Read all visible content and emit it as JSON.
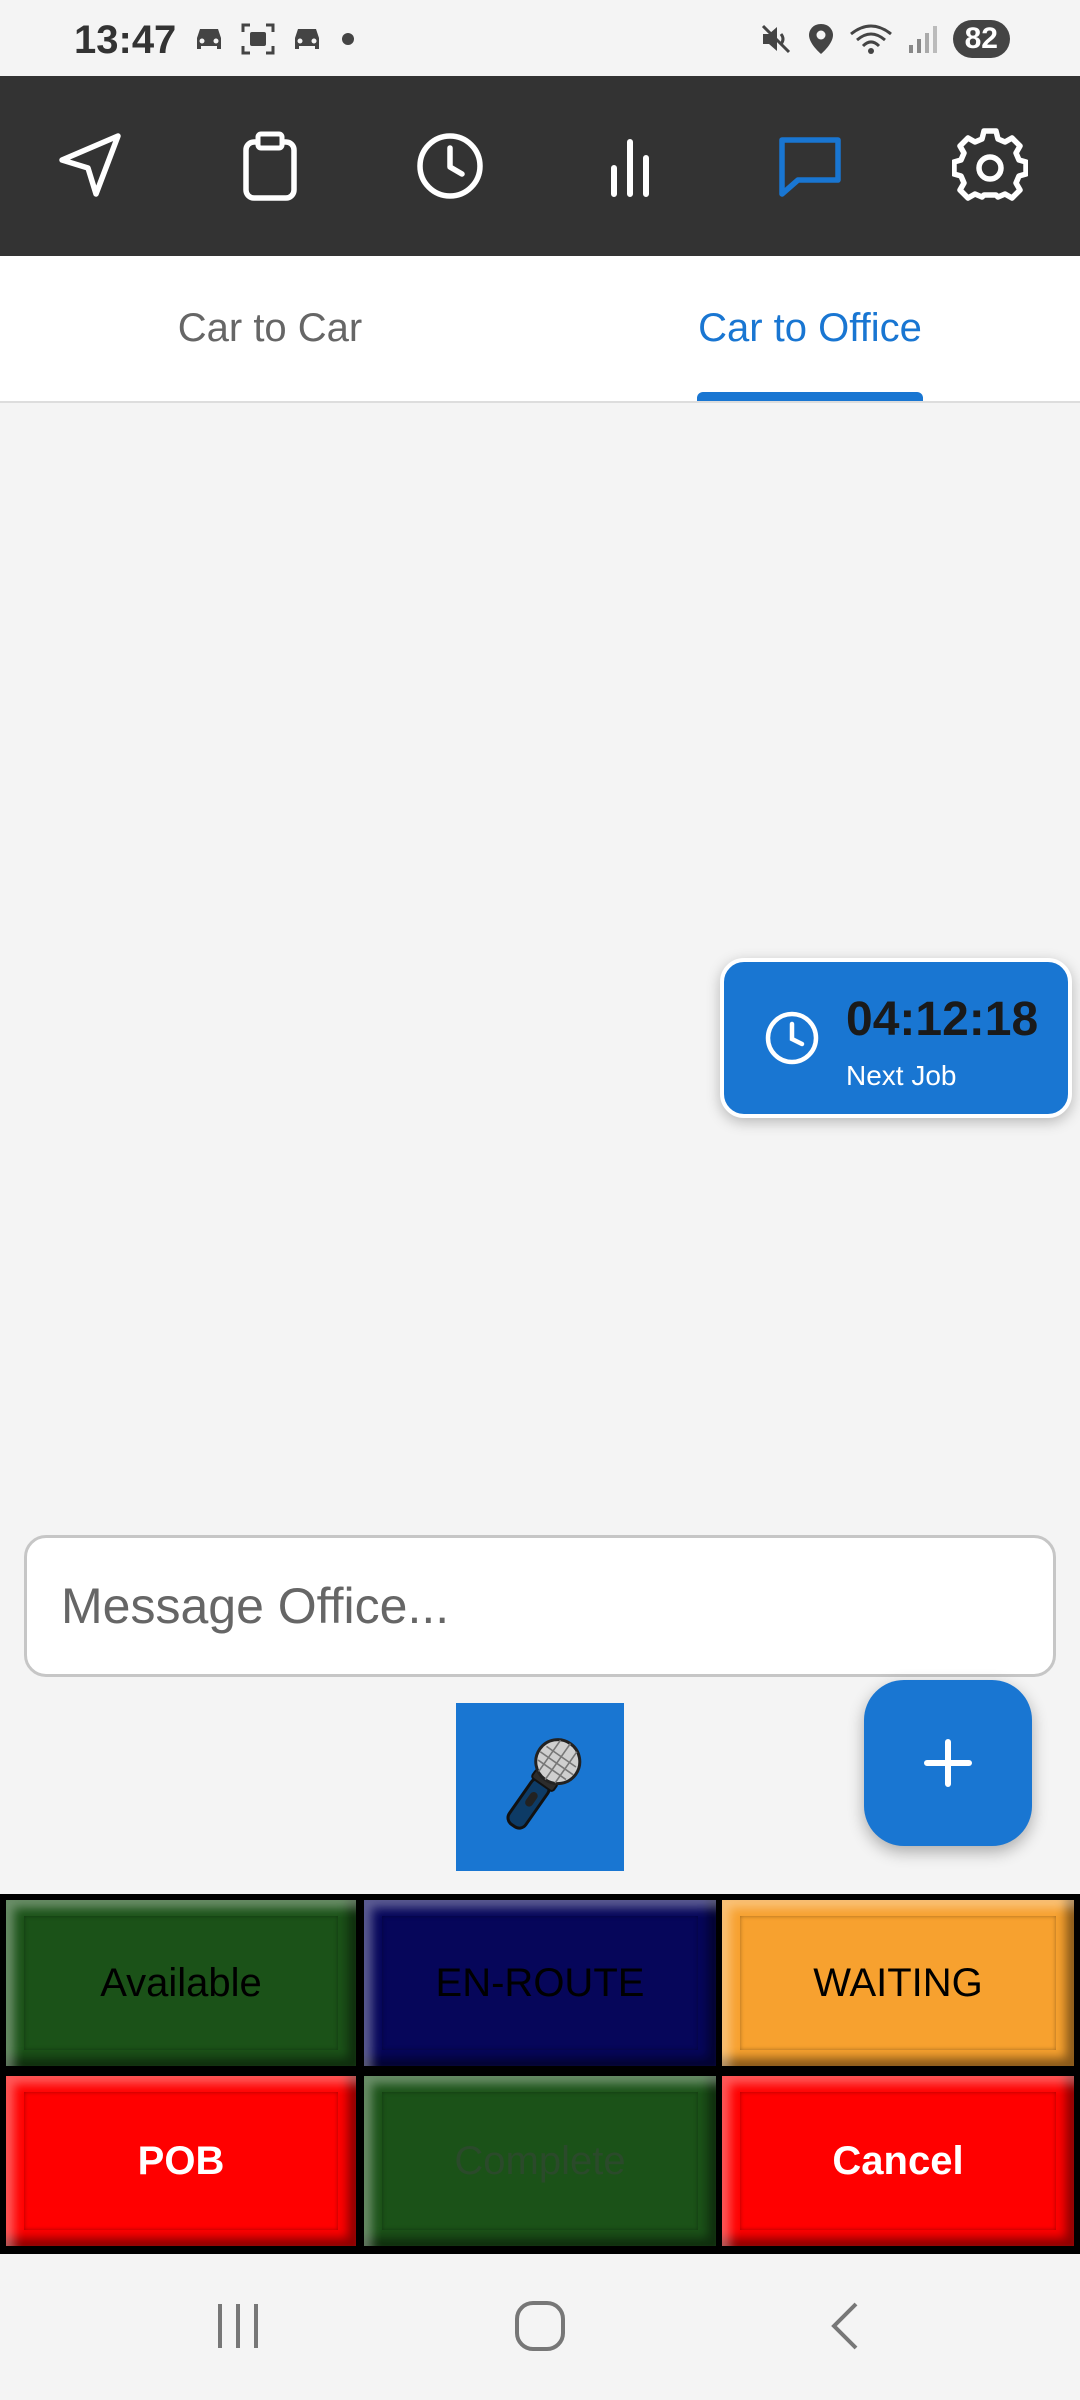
{
  "status_bar": {
    "time": "13:47",
    "battery": "82",
    "left_icons": [
      "car-icon",
      "screenshot-icon",
      "car-icon",
      "dot-icon"
    ],
    "right_icons": [
      "mute-icon",
      "location-icon",
      "wifi-icon",
      "signal-icon"
    ]
  },
  "top_nav": {
    "items": [
      {
        "icon": "navigation-arrow-icon",
        "active": false
      },
      {
        "icon": "clipboard-icon",
        "active": false
      },
      {
        "icon": "clock-icon",
        "active": false
      },
      {
        "icon": "bar-chart-icon",
        "active": false
      },
      {
        "icon": "message-icon",
        "active": true
      },
      {
        "icon": "gear-icon",
        "active": false
      }
    ],
    "active_color": "#1976d2"
  },
  "tabs": [
    {
      "label": "Car to Car",
      "active": false
    },
    {
      "label": "Car to Office",
      "active": true
    }
  ],
  "timer": {
    "value": "04:12:18",
    "label": "Next Job"
  },
  "message": {
    "placeholder": "Message Office...",
    "value": ""
  },
  "status_buttons": [
    {
      "label": "Available",
      "color": "#1b5218",
      "text_color": "#000000"
    },
    {
      "label": "EN-ROUTE",
      "color": "#06065a",
      "text_color": "#000000"
    },
    {
      "label": "WAITING",
      "color": "#f7a12f",
      "text_color": "#000000"
    },
    {
      "label": "POB",
      "color": "#ff0000",
      "text_color": "#ffffff"
    },
    {
      "label": "Complete",
      "color": "#1b5218",
      "text_color": "#2b4a2b"
    },
    {
      "label": "Cancel",
      "color": "#ff0000",
      "text_color": "#ffffff"
    }
  ],
  "colors": {
    "primary": "#1976d2",
    "nav_bg": "#333333"
  }
}
